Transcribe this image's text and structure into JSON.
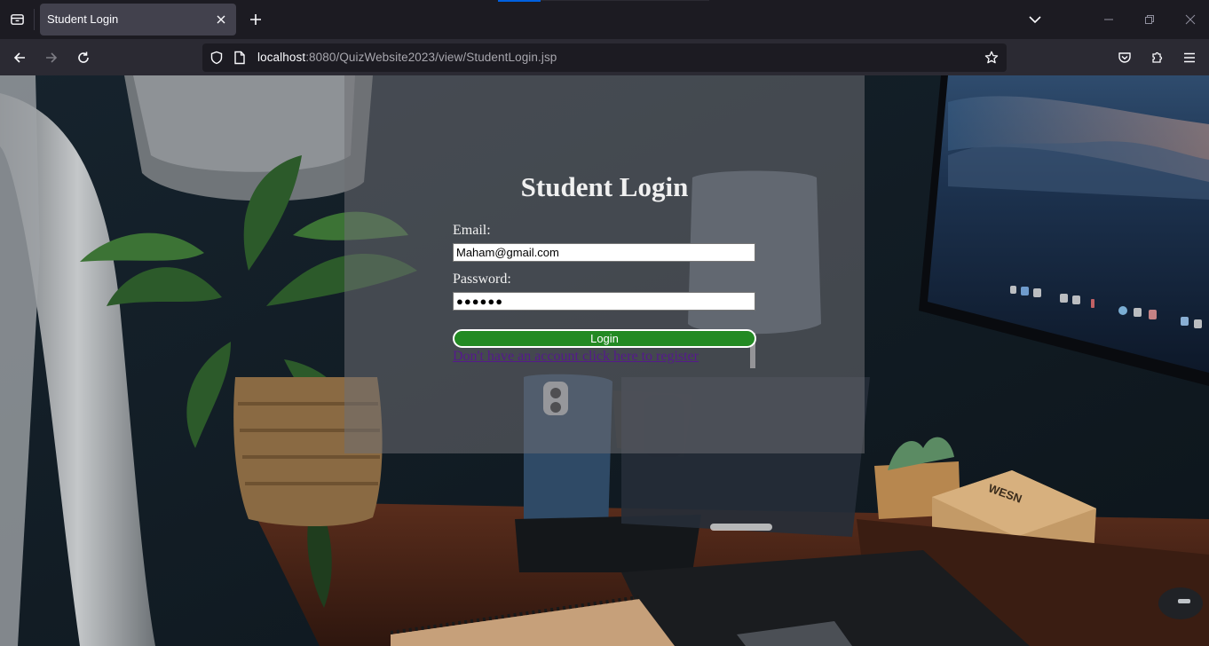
{
  "browser": {
    "tab_title": "Student Login",
    "url_host": "localhost",
    "url_rest": ":8080/QuizWebsite2023/view/StudentLogin.jsp"
  },
  "page": {
    "title": "Student Login",
    "email_label": "Email:",
    "email_value": "Maham@gmail.com",
    "password_label": "Password:",
    "password_masked": "●●●●●●",
    "login_button": "Login",
    "register_link": "Don't have an account click here to register"
  },
  "colors": {
    "button_green": "#238a23",
    "link_visited": "#551a8b",
    "panel_overlay": "rgba(110,110,115,0.55)"
  },
  "icons": [
    "tab-list-icon",
    "close-tab-icon",
    "new-tab-icon",
    "chevron-down-icon",
    "minimize-icon",
    "restore-icon",
    "close-window-icon",
    "back-icon",
    "forward-icon",
    "reload-icon",
    "shield-icon",
    "page-icon",
    "star-icon",
    "pocket-icon",
    "extensions-icon",
    "menu-icon"
  ]
}
